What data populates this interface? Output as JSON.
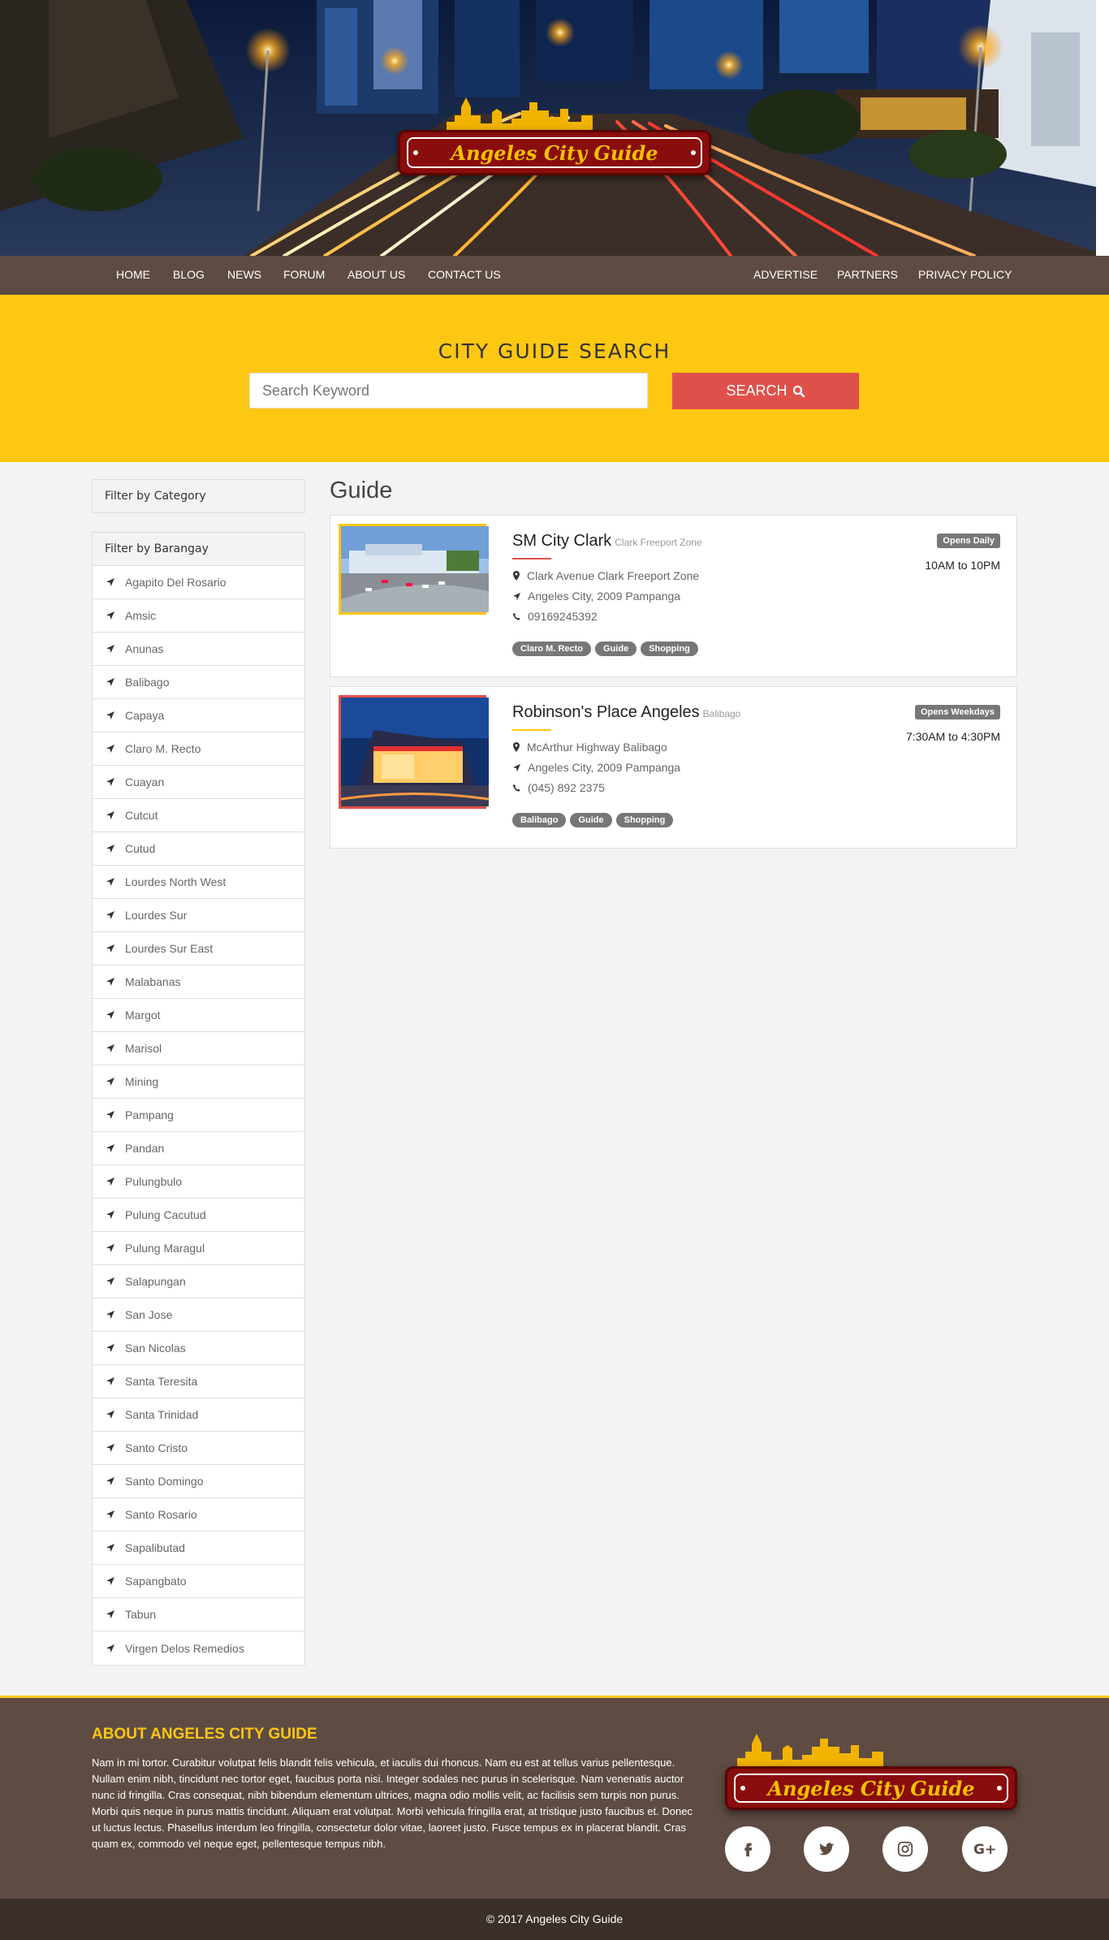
{
  "site": {
    "logo_text": "Angeles City Guide"
  },
  "nav": {
    "left": [
      "HOME",
      "BLOG",
      "NEWS",
      "FORUM",
      "ABOUT US",
      "CONTACT US"
    ],
    "right": [
      "ADVERTISE",
      "PARTNERS",
      "PRIVACY POLICY"
    ]
  },
  "search": {
    "title": "CITY GUIDE SEARCH",
    "placeholder": "Search Keyword",
    "button_label": "SEARCH"
  },
  "sidebar": {
    "category_header": "Filter by Category",
    "barangay_header": "Filter by Barangay",
    "barangays": [
      "Agapito Del Rosario",
      "Amsic",
      "Anunas",
      "Balibago",
      "Capaya",
      "Claro M. Recto",
      "Cuayan",
      "Cutcut",
      "Cutud",
      "Lourdes North West",
      "Lourdes Sur",
      "Lourdes Sur East",
      "Malabanas",
      "Margot",
      "Marisol",
      "Mining",
      "Pampang",
      "Pandan",
      "Pulungbulo",
      "Pulung Cacutud",
      "Pulung Maragul",
      "Salapungan",
      "San Jose",
      "San Nicolas",
      "Santa Teresita",
      "Santa Trinidad",
      "Santo Cristo",
      "Santo Domingo",
      "Santo Rosario",
      "Sapalibutad",
      "Sapangbato",
      "Tabun",
      "Virgen Delos Remedios"
    ]
  },
  "main": {
    "title": "Guide",
    "listings": [
      {
        "name": "SM City Clark",
        "area": "Clark Freeport Zone",
        "address": "Clark Avenue Clark Freeport Zone",
        "city": "Angeles City, 2009 Pampanga",
        "phone": "09169245392",
        "tags": [
          "Claro M. Recto",
          "Guide",
          "Shopping"
        ],
        "badge": "Opens Daily",
        "hours": "10AM to 10PM",
        "accent": "#e0504a",
        "border": "#fec712"
      },
      {
        "name": "Robinson's Place Angeles",
        "area": "Balibago",
        "address": "McArthur Highway Balibago",
        "city": "Angeles City, 2009 Pampanga",
        "phone": "(045) 892 2375",
        "tags": [
          "Balibago",
          "Guide",
          "Shopping"
        ],
        "badge": "Opens Weekdays",
        "hours": "7:30AM to 4:30PM",
        "accent": "#fec712",
        "border": "#e0504a"
      }
    ]
  },
  "footer": {
    "title": "ABOUT ANGELES CITY GUIDE",
    "text": "Nam in mi tortor. Curabitur volutpat felis blandit felis vehicula, et iaculis dui rhoncus. Nam eu est at tellus varius pellentesque. Nullam enim nibh, tincidunt nec tortor eget, faucibus porta nisi. Integer sodales nec purus in scelerisque. Nam venenatis auctor nunc id fringilla. Cras consequat, nibh bibendum elementum ultrices, magna odio mollis velit, ac facilisis sem turpis non purus. Morbi quis neque in purus mattis tincidunt. Aliquam erat volutpat. Morbi vehicula fringilla erat, at tristique justo faucibus et. Donec ut luctus lectus. Phasellus interdum leo fringilla, consectetur dolor vitae, laoreet justo. Fusce tempus ex in placerat blandit. Cras quam ex, commodo vel neque eget, pellentesque tempus nibh.",
    "social": [
      "facebook-icon",
      "twitter-icon",
      "instagram-icon",
      "google-plus-icon"
    ],
    "copyright": "© 2017 Angeles City Guide"
  },
  "colors": {
    "brand_yellow": "#fec712",
    "brand_red": "#e0504a",
    "nav_brown": "#5e4c43",
    "logo_maroon": "#8a0d0d"
  }
}
